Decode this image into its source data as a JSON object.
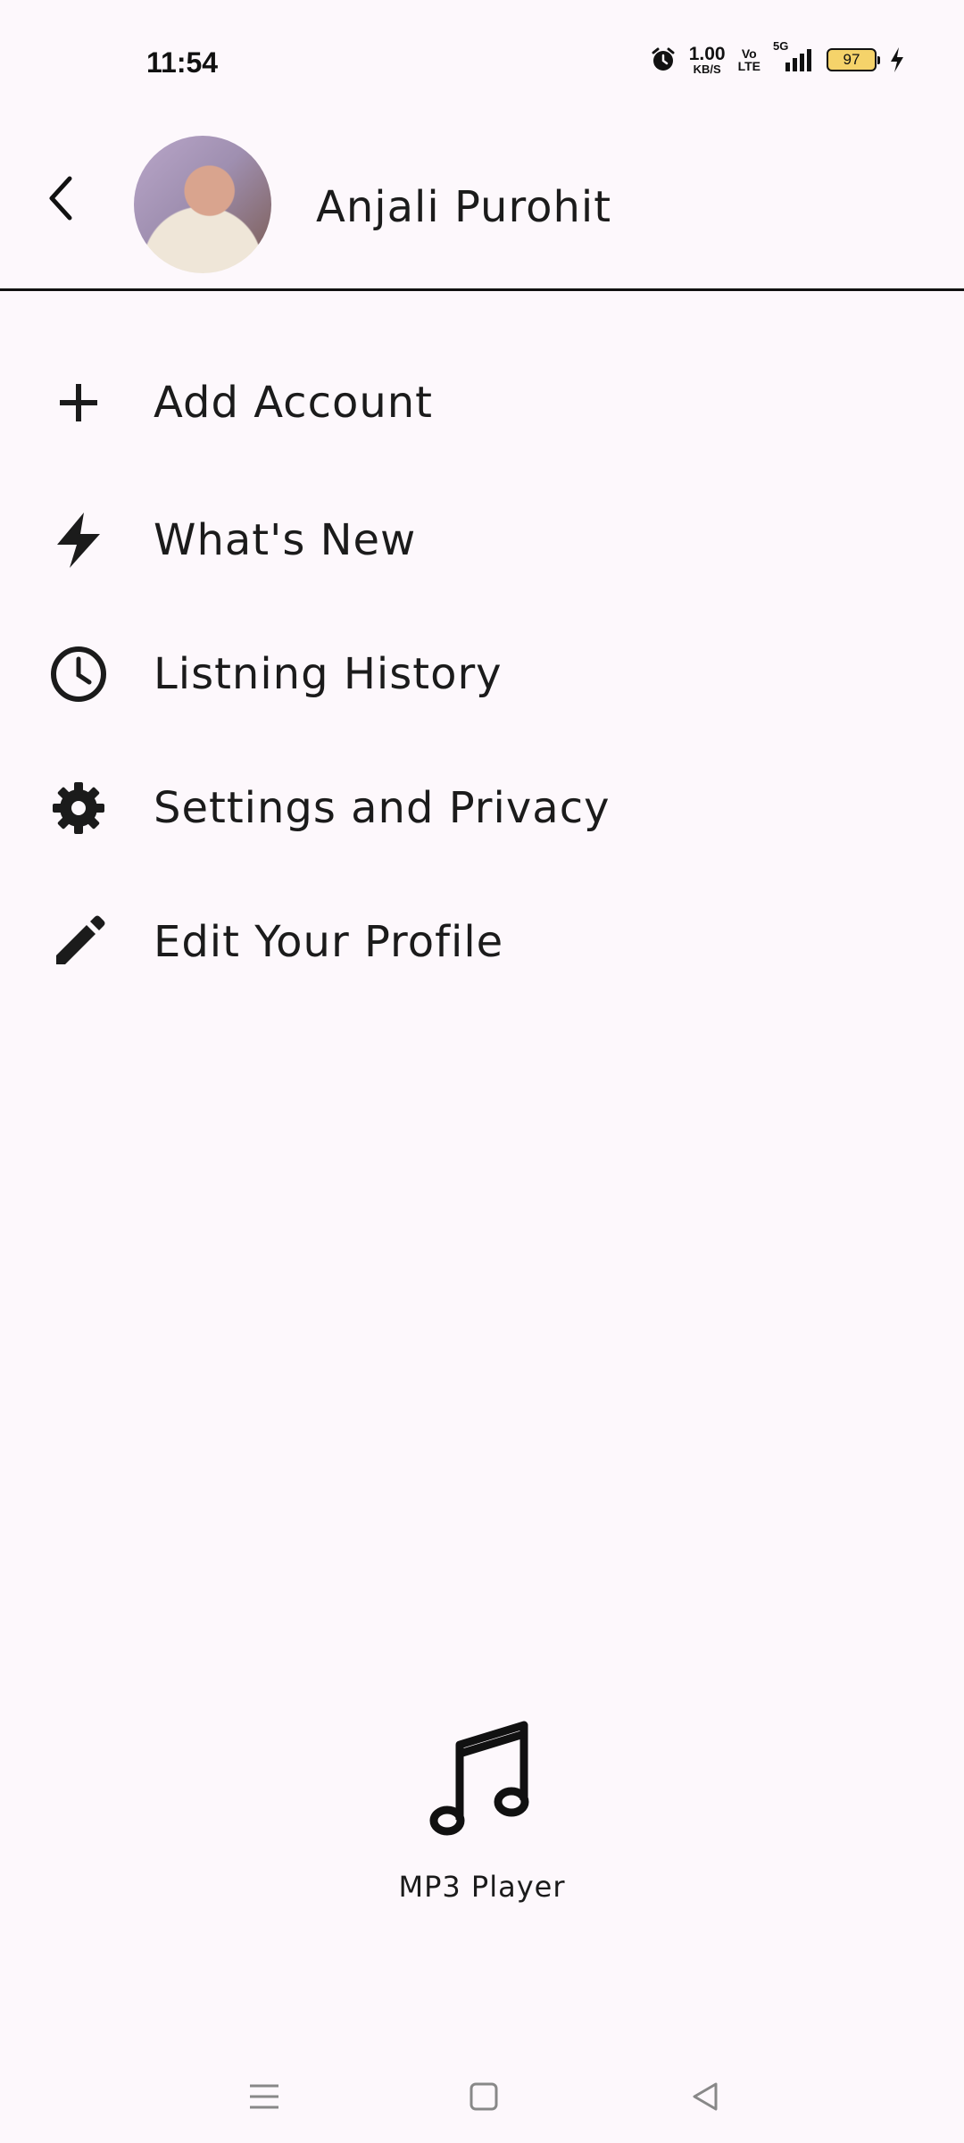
{
  "status_bar": {
    "time": "11:54",
    "net_speed_value": "1.00",
    "net_speed_unit": "KB/S",
    "volte_top": "Vo",
    "volte_bottom": "LTE",
    "network_type": "5G",
    "battery_level": "97",
    "icons": [
      "alarm-icon",
      "signal-icon",
      "battery-icon",
      "charging-icon"
    ]
  },
  "header": {
    "back_icon": "chevron-left-icon",
    "user_name": "Anjali Purohit"
  },
  "menu": {
    "items": [
      {
        "label": "Add Account",
        "icon": "plus-icon"
      },
      {
        "label": "What's New",
        "icon": "lightning-icon"
      },
      {
        "label": "Listning History",
        "icon": "clock-icon"
      },
      {
        "label": "Settings and Privacy",
        "icon": "gear-icon"
      },
      {
        "label": "Edit Your Profile",
        "icon": "pencil-icon"
      }
    ]
  },
  "app": {
    "name": "MP3 Player",
    "icon": "music-note-icon"
  },
  "nav": {
    "icons": [
      "menu-icon",
      "home-icon",
      "back-triangle-icon"
    ]
  }
}
